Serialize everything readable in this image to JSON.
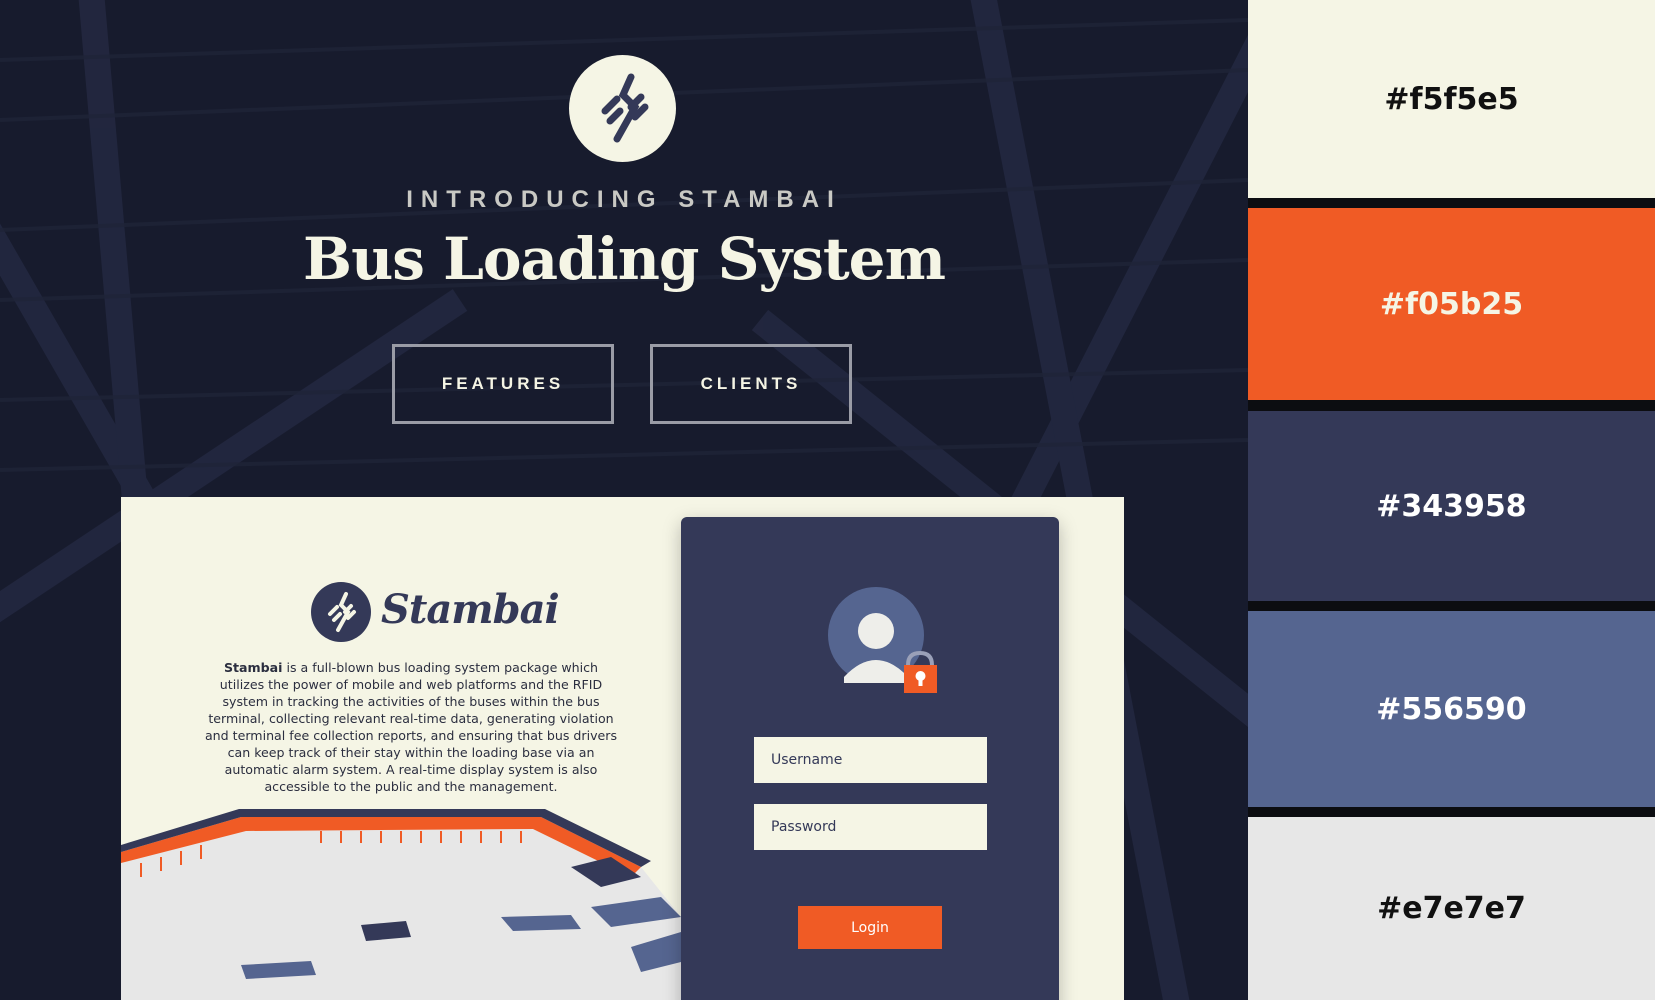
{
  "hero": {
    "eyebrow": "INTRODUCING STAMBAI",
    "title": "Bus Loading System",
    "buttons": {
      "features": "FEATURES",
      "clients": "CLIENTS"
    }
  },
  "mockup": {
    "brand": "Stambai",
    "description_bold": "Stambai",
    "description_rest": " is a full-blown bus loading system package which utilizes the power of mobile and web platforms and the RFID system in tracking the activities of the buses within the bus terminal, collecting relevant real-time data, generating violation and terminal fee collection reports, and ensuring that bus drivers can keep track of their stay within the loading base via an automatic alarm system. A real-time display system is also accessible to the public and the management.",
    "login": {
      "username_placeholder": "Username",
      "password_placeholder": "Password",
      "button": "Login"
    }
  },
  "palette": [
    {
      "label": "#f5f5e5",
      "color": "#f5f5e5",
      "text_color": "#111111"
    },
    {
      "label": "#f05b25",
      "color": "#f05b25",
      "text_color": "#f5f5e5"
    },
    {
      "label": "#343958",
      "color": "#343958",
      "text_color": "#ffffff"
    },
    {
      "label": "#556590",
      "color": "#556590",
      "text_color": "#ffffff"
    },
    {
      "label": "#e7e7e7",
      "color": "#e7e7e7",
      "text_color": "#111111"
    }
  ]
}
